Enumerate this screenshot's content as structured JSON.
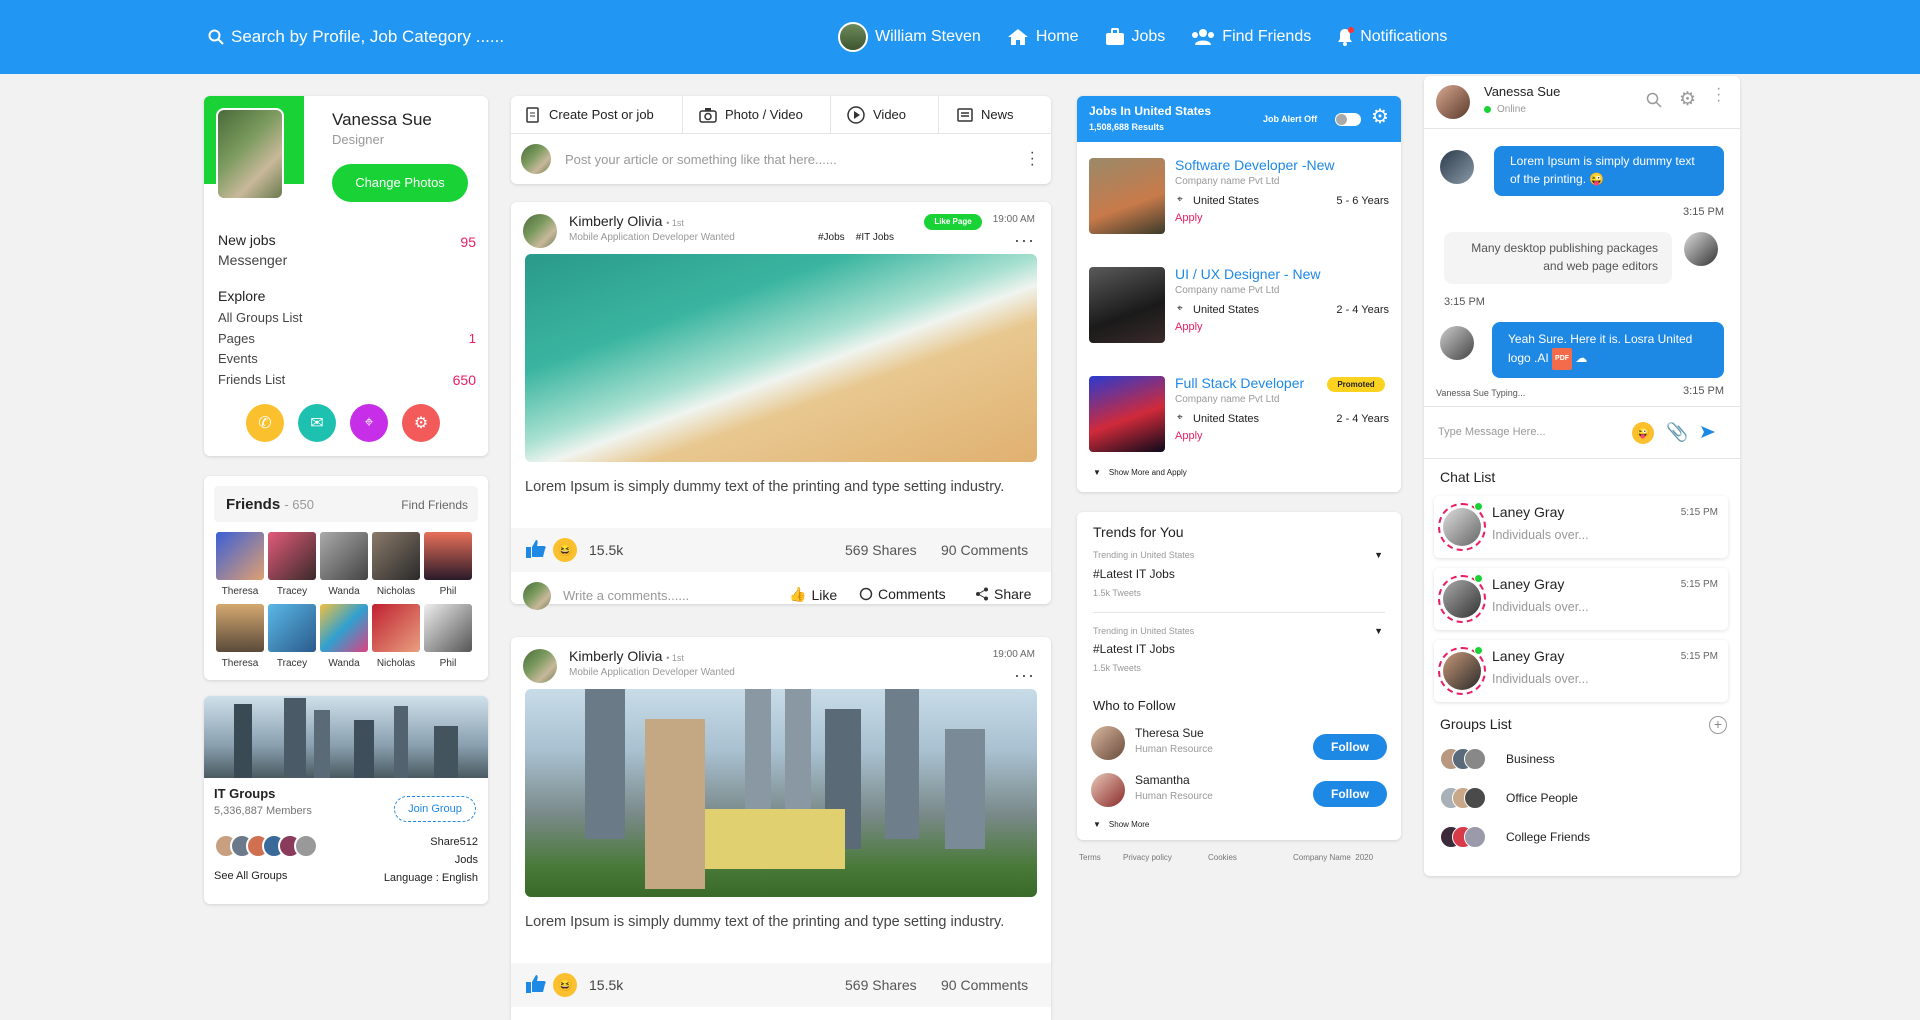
{
  "topbar": {
    "search_placeholder": "Search by Profile, Job Category ......",
    "user_name": "William Steven",
    "nav": [
      "Home",
      "Jobs",
      "Find Friends",
      "Notifications"
    ]
  },
  "profile": {
    "name": "Vanessa Sue",
    "role": "Designer",
    "change_photos": "Change Photos",
    "new_jobs_label": "New jobs",
    "new_jobs_count": "95",
    "messenger": "Messenger",
    "explore_title": "Explore",
    "explore": [
      {
        "label": "All Groups List",
        "count": ""
      },
      {
        "label": "Pages",
        "count": "1"
      },
      {
        "label": "Events",
        "count": ""
      },
      {
        "label": "Friends List",
        "count": "650"
      }
    ]
  },
  "friends": {
    "title": "Friends",
    "count": "- 650",
    "find": "Find Friends",
    "names": [
      "Theresa",
      "Tracey",
      "Wanda",
      "Nicholas",
      "Phil",
      "Theresa",
      "Tracey",
      "Wanda",
      "Nicholas",
      "Phil"
    ]
  },
  "group": {
    "title": "IT Groups",
    "members": "5,336,887 Members",
    "join": "Join Group",
    "share": "Share512",
    "jods": "Jods",
    "language": "Language : English",
    "see_all": "See All Groups"
  },
  "composer": {
    "tabs": [
      "Create Post or job",
      "Photo / Video",
      "Video",
      "News"
    ],
    "placeholder": "Post your article or something like that here......"
  },
  "posts": [
    {
      "author": "Kimberly Olivia",
      "degree": "• 1st",
      "subtitle": "Mobile Application Developer Wanted",
      "tags": "#Jobs    #IT Jobs",
      "like_page": "Like Page",
      "time": "19:00 AM",
      "text": "Lorem Ipsum is simply dummy text of the printing and type setting industry.",
      "reactions": "15.5k",
      "shares": "569 Shares",
      "comments": "90 Comments",
      "comment_placeholder": "Write a comments......",
      "actions": [
        "Like",
        "Comments",
        "Share"
      ]
    },
    {
      "author": "Kimberly Olivia",
      "degree": "• 1st",
      "subtitle": "Mobile Application Developer Wanted",
      "time": "19:00 AM",
      "text": "Lorem Ipsum is simply dummy text of the printing and type setting industry.",
      "reactions": "15.5k",
      "shares": "569 Shares",
      "comments": "90 Comments"
    }
  ],
  "jobs": {
    "title": "Jobs In United States",
    "results": "1,508,688 Results",
    "alert": "Job Alert Off",
    "items": [
      {
        "title": "Software Developer -New",
        "company": "Company name Pvt Ltd",
        "location": "United States",
        "exp": "5 - 6 Years",
        "apply": "Apply",
        "badge": ""
      },
      {
        "title": "UI / UX Designer - New",
        "company": "Company name Pvt Ltd",
        "location": "United States",
        "exp": "2 - 4 Years",
        "apply": "Apply",
        "badge": ""
      },
      {
        "title": "Full Stack Developer",
        "company": "Company name Pvt Ltd",
        "location": "United States",
        "exp": "2 - 4 Years",
        "apply": "Apply",
        "badge": "Promoted"
      }
    ],
    "show_more": "Show More and Apply"
  },
  "trends": {
    "title": "Trends for You",
    "items": [
      {
        "context": "Trending in United States",
        "tag": "#Latest IT Jobs",
        "tweets": "1.5k Tweets"
      },
      {
        "context": "Trending in United States",
        "tag": "#Latest IT Jobs",
        "tweets": "1.5k Tweets"
      }
    ],
    "who_title": "Who to Follow",
    "follow": [
      {
        "name": "Theresa Sue",
        "role": "Human Resource",
        "button": "Follow"
      },
      {
        "name": "Samantha",
        "role": "Human Resource",
        "button": "Follow"
      }
    ],
    "show_more": "Show More"
  },
  "footer": [
    "Terms",
    "Privacy policy",
    "Cookies",
    "Company Name  2020"
  ],
  "chat": {
    "name": "Vanessa Sue",
    "status": "Online",
    "messages": [
      {
        "text": "Lorem Ipsum is simply dummy text of the printing. 😜",
        "time": "3:15 PM"
      },
      {
        "text": "Many desktop publishing packages and web page editors",
        "time": "3:15 PM"
      },
      {
        "text": "Yeah Sure. Here it is. Losra United logo .AI",
        "time": "3:15 PM"
      }
    ],
    "typing": "Vanessa Sue Typing...",
    "input_placeholder": "Type Message Here...",
    "chat_list_title": "Chat List",
    "chat_list": [
      {
        "name": "Laney Gray",
        "preview": "Individuals over...",
        "time": "5:15 PM"
      },
      {
        "name": "Laney Gray",
        "preview": "Individuals over...",
        "time": "5:15 PM"
      },
      {
        "name": "Laney Gray",
        "preview": "Individuals over...",
        "time": "5:15 PM"
      }
    ],
    "groups_title": "Groups List",
    "groups": [
      "Business",
      "Office People",
      "College Friends"
    ]
  },
  "colors": {
    "primary": "#2196f3",
    "accent_green": "#19d336",
    "accent_pink": "#e91e63"
  }
}
